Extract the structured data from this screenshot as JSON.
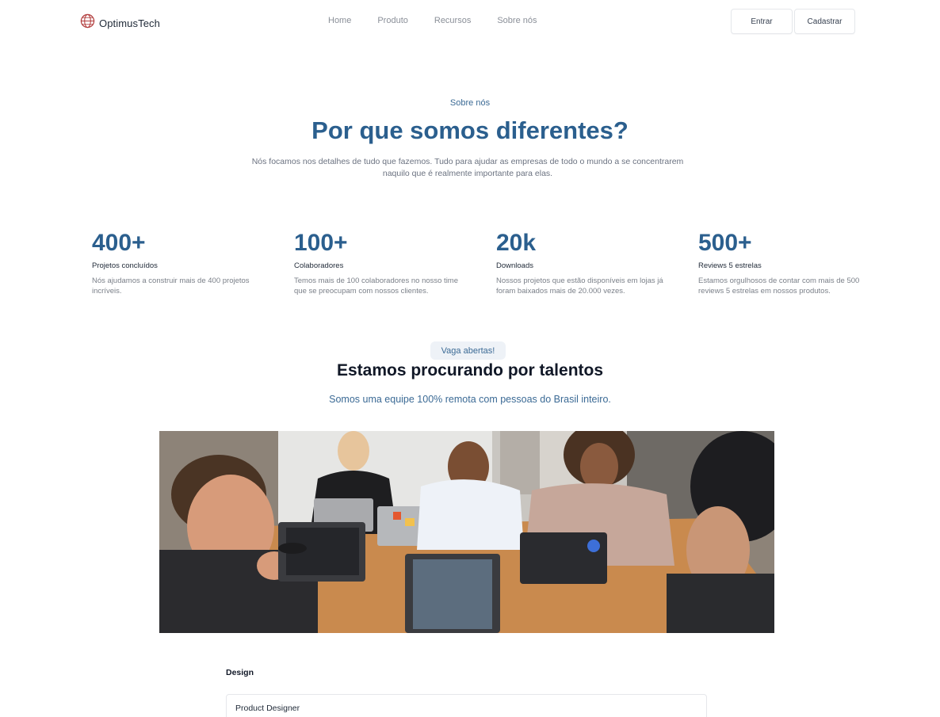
{
  "brand": {
    "name": "OptimusTech",
    "icon": "globe-icon",
    "accent": "#b13b3b"
  },
  "nav": {
    "links": [
      "Home",
      "Produto",
      "Recursos",
      "Sobre nós"
    ]
  },
  "auth": {
    "login_label": "Entrar",
    "signup_label": "Cadastrar"
  },
  "hero": {
    "eyebrow": "Sobre nós",
    "title": "Por que somos diferentes?",
    "subtitle_line1": "Nós focamos nos detalhes de tudo que fazemos. Tudo para ajudar as empresas de todo o mundo a se concentrarem",
    "subtitle_line2": "naquilo que é realmente importante para elas."
  },
  "stats": [
    {
      "value": "400+",
      "label": "Projetos concluídos",
      "desc_line1": "Nós ajudamos a construir mais de 400 projetos",
      "desc_line2": "incríveis."
    },
    {
      "value": "100+",
      "label": "Colaboradores",
      "desc_line1": "Temos mais de 100 colaboradores no nosso time",
      "desc_line2": "que se preocupam com nossos clientes."
    },
    {
      "value": "20k",
      "label": "Downloads",
      "desc_line1": "Nossos projetos que estão disponíveis em lojas já",
      "desc_line2": "foram baixados mais de 20.000 vezes."
    },
    {
      "value": "500+",
      "label": "Reviews 5 estrelas",
      "desc_line1": "Estamos orgulhosos de contar com mais de 500",
      "desc_line2": "reviews 5 estrelas em nossos produtos."
    }
  ],
  "jobs": {
    "badge": "Vaga abertas!",
    "title": "Estamos procurando por talentos",
    "subtitle": "Somos uma equipe 100% remota com pessoas do Brasil inteiro.",
    "category": "Design",
    "first_job": "Product Designer"
  },
  "colors": {
    "primary": "#2b5f8e",
    "muted": "#6b7280",
    "badge_bg": "#eef2f7"
  }
}
